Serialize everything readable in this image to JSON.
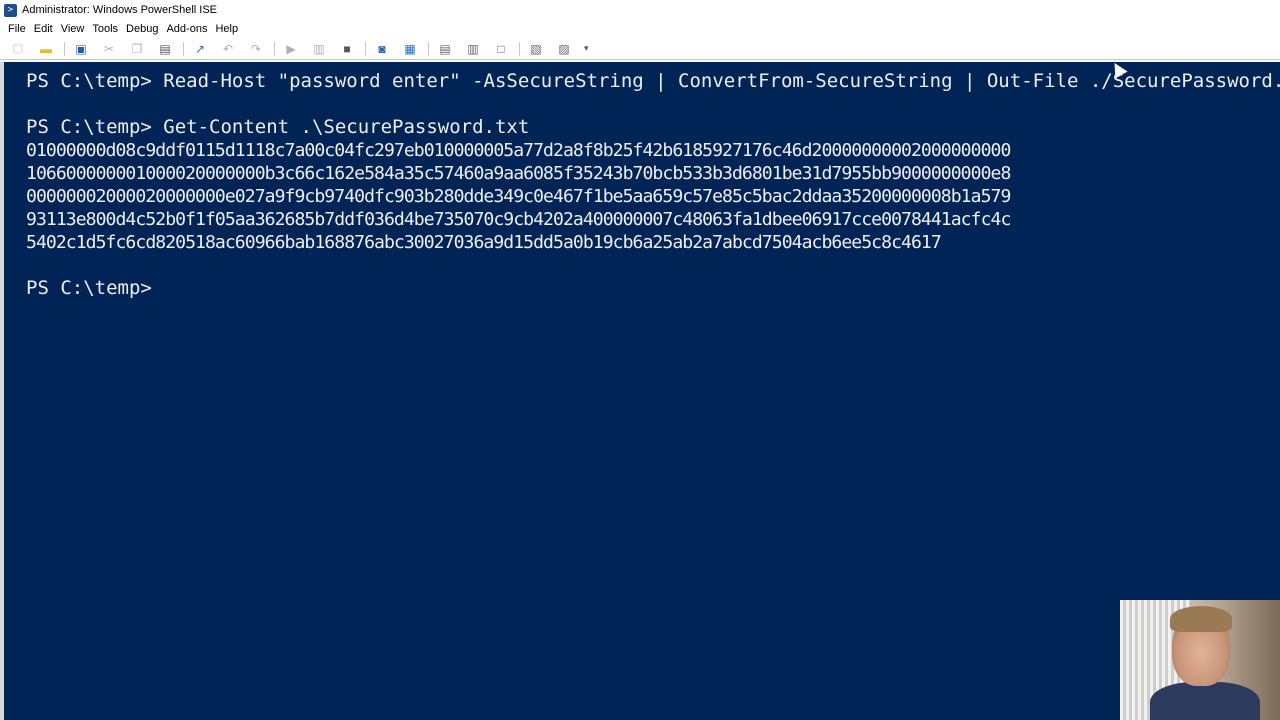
{
  "window": {
    "title": "Administrator: Windows PowerShell ISE",
    "icon": "powershell-icon"
  },
  "menu": [
    "File",
    "Edit",
    "View",
    "Tools",
    "Debug",
    "Add-ons",
    "Help"
  ],
  "toolbar": {
    "icons": [
      {
        "name": "new-icon",
        "glyph": "☐",
        "color": "#ffffff"
      },
      {
        "name": "open-icon",
        "glyph": "▬",
        "color": "#e8b830"
      },
      {
        "name": "save-icon",
        "glyph": "▣",
        "color": "#2a5ba8"
      },
      {
        "name": "cut-icon",
        "glyph": "✂",
        "color": "#b0b0b0"
      },
      {
        "name": "copy-icon",
        "glyph": "❐",
        "color": "#b0b0b0"
      },
      {
        "name": "paste-icon",
        "glyph": "▤",
        "color": "#555555"
      },
      {
        "name": "clear-console-icon",
        "glyph": "↗",
        "color": "#3a6ab0"
      },
      {
        "name": "undo-icon",
        "glyph": "↶",
        "color": "#b0b0b0"
      },
      {
        "name": "redo-icon",
        "glyph": "↷",
        "color": "#b0b0b0"
      },
      {
        "name": "run-script-icon",
        "glyph": "▶",
        "color": "#b0b0b0"
      },
      {
        "name": "run-selection-icon",
        "glyph": "▥",
        "color": "#b0b0b0"
      },
      {
        "name": "stop-icon",
        "glyph": "■",
        "color": "#555555"
      },
      {
        "name": "remote-powershell-icon",
        "glyph": "◙",
        "color": "#2a5ba8"
      },
      {
        "name": "start-powershell-icon",
        "glyph": "▦",
        "color": "#2a6ac8"
      },
      {
        "name": "show-script-pane-top-icon",
        "glyph": "▤",
        "color": "#666666"
      },
      {
        "name": "show-script-pane-right-icon",
        "glyph": "▥",
        "color": "#666666"
      },
      {
        "name": "show-script-pane-maximized-icon",
        "glyph": "□",
        "color": "#666666"
      },
      {
        "name": "show-command-window-icon",
        "glyph": "▧",
        "color": "#666666"
      },
      {
        "name": "show-command-addon-icon",
        "glyph": "▨",
        "color": "#666666"
      }
    ],
    "overflow": "▾"
  },
  "console": {
    "background": "#012456",
    "foreground": "#eeedf0",
    "lines": [
      "PS C:\\temp> Read-Host \"password enter\" -AsSecureString | ConvertFrom-SecureString | Out-File ./SecurePassword.txt",
      "",
      "PS C:\\temp> Get-Content .\\SecurePassword.txt",
      "01000000d08c9ddf0115d1118c7a00c04fc297eb010000005a77d2a8f8b25f42b6185927176c46d20000000002000000000",
      "106600000001000020000000b3c66c162e584a35c57460a9aa6085f35243b70bcb533b3d6801be31d7955bb9000000000e8",
      "00000002000020000000e027a9f9cb9740dfc903b280dde349c0e467f1be5aa659c57e85c5bac2ddaa35200000008b1a579",
      "93113e800d4c52b0f1f05aa362685b7ddf036d4be735070c9cb4202a400000007c48063fa1dbee06917cce0078441acfc4c",
      "5402c1d5fc6cd820518ac60966bab168876abc30027036a9d15dd5a0b19cb6a25ab2a7abcd7504acb6ee5c8c4617",
      "",
      "PS C:\\temp> "
    ]
  }
}
